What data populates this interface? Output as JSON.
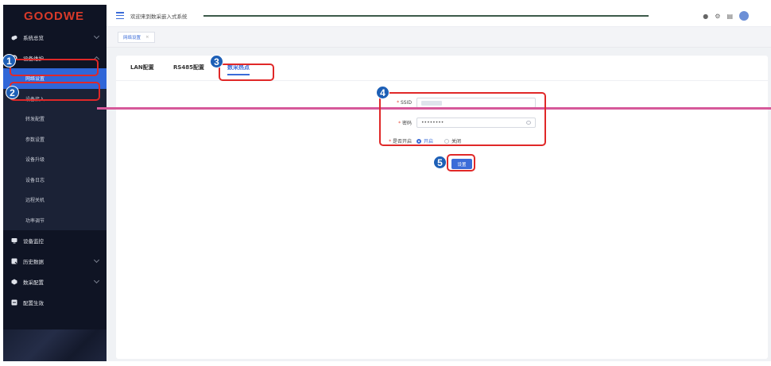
{
  "app": {
    "logo": "GOODWE",
    "welcome": "欢迎来到数采嵌入式系统"
  },
  "sidebar": {
    "groups": [
      {
        "label": "系统总览",
        "icon": "cloud-icon",
        "chevron": "down"
      },
      {
        "label": "设备维护",
        "icon": "gear-icon",
        "chevron": "up"
      },
      {
        "label": "设备监控",
        "icon": "monitor-icon"
      },
      {
        "label": "历史数据",
        "icon": "history-icon",
        "chevron": "down"
      },
      {
        "label": "数采配置",
        "icon": "config-icon",
        "chevron": "down"
      },
      {
        "label": "配置生效",
        "icon": "apply-icon"
      }
    ],
    "sub_items": [
      "网络设置",
      "设备接入",
      "转发配置",
      "参数设置",
      "设备升级",
      "设备日志",
      "远程关机",
      "功率调节"
    ]
  },
  "tabstrip": {
    "tab_label": "网络设置",
    "close": "×"
  },
  "inner_tabs": [
    "LAN配置",
    "RS485配置",
    "数采热点"
  ],
  "form": {
    "ssid_label": "SSID",
    "password_label": "密码",
    "password_value": "••••••••",
    "enable_label": "是否开启",
    "enable_on": "开启",
    "enable_off": "关闭",
    "required_mark": "*",
    "submit": "设置"
  },
  "annotations": [
    "1",
    "2",
    "3",
    "4",
    "5"
  ],
  "colors": {
    "accent": "#3b6cd8",
    "sidebar": "#0f1424",
    "annotation": "#e02828",
    "badge": "#1d5fb6"
  }
}
